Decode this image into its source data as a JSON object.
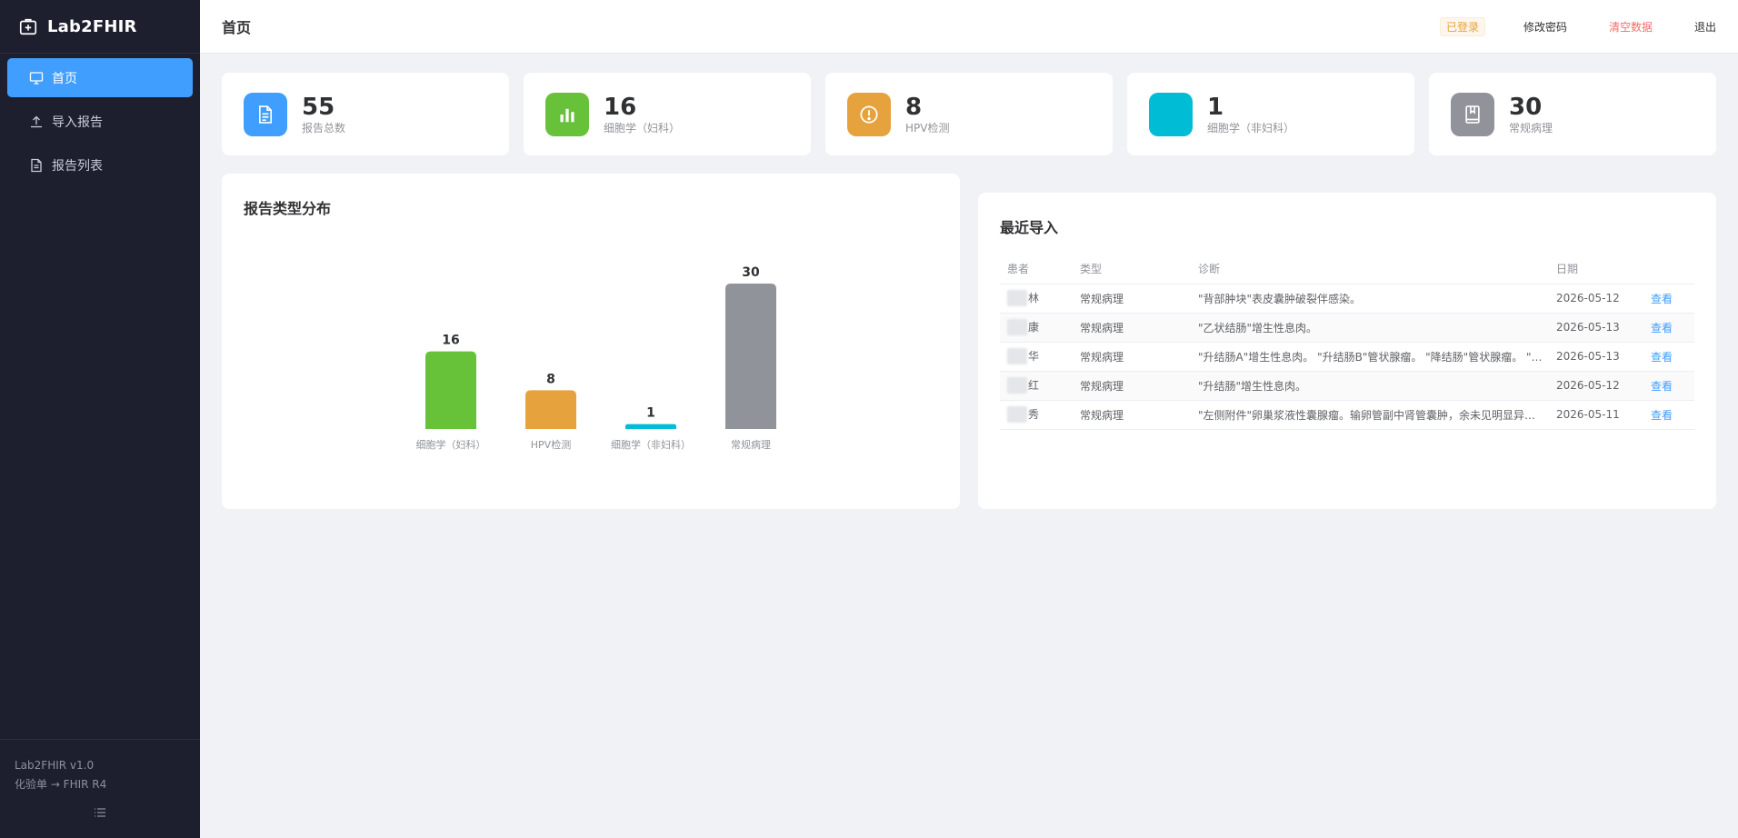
{
  "app": {
    "name": "Lab2FHIR"
  },
  "sidebar": {
    "items": [
      {
        "label": "首页",
        "icon": "monitor-icon",
        "active": true
      },
      {
        "label": "导入报告",
        "icon": "upload-icon",
        "active": false
      },
      {
        "label": "报告列表",
        "icon": "document-icon",
        "active": false
      }
    ],
    "footer": {
      "version": "Lab2FHIR v1.0",
      "tagline": "化验单 → FHIR R4"
    }
  },
  "header": {
    "title": "首页",
    "status": "已登录",
    "change_password": "修改密码",
    "clear_data": "清空数据",
    "logout": "退出"
  },
  "stats": [
    {
      "value": "55",
      "label": "报告总数",
      "color": "#409eff",
      "icon": "document-icon"
    },
    {
      "value": "16",
      "label": "细胞学（妇科）",
      "color": "#67c23a",
      "icon": "bar-chart-icon"
    },
    {
      "value": "8",
      "label": "HPV检测",
      "color": "#e6a23c",
      "icon": "warning-icon"
    },
    {
      "value": "1",
      "label": "细胞学（非妇科）",
      "color": "#00bcd4",
      "icon": ""
    },
    {
      "value": "30",
      "label": "常规病理",
      "color": "#909399",
      "icon": "book-icon"
    }
  ],
  "chart_panel": {
    "title": "报告类型分布"
  },
  "chart_data": {
    "type": "bar",
    "title": "报告类型分布",
    "categories": [
      "细胞学（妇科）",
      "HPV检测",
      "细胞学（非妇科）",
      "常规病理"
    ],
    "values": [
      16,
      8,
      1,
      30
    ],
    "colors": [
      "#67c23a",
      "#e6a23c",
      "#00bcd4",
      "#909399"
    ],
    "ylim": [
      0,
      30
    ],
    "grid": false
  },
  "recent": {
    "title": "最近导入",
    "columns": [
      "患者",
      "类型",
      "诊断",
      "日期",
      ""
    ],
    "rows": [
      {
        "patient": "林",
        "type": "常规病理",
        "diagnosis": "\"背部肿块\"表皮囊肿破裂伴感染。",
        "date": "2026-05-12",
        "action": "查看"
      },
      {
        "patient": "康",
        "type": "常规病理",
        "diagnosis": "\"乙状结肠\"增生性息肉。",
        "date": "2026-05-13",
        "action": "查看"
      },
      {
        "patient": "华",
        "type": "常规病理",
        "diagnosis": "\"升结肠A\"增生性息肉。 \"升结肠B\"管状腺瘤。 \"降结肠\"管状腺瘤。 \"…",
        "date": "2026-05-13",
        "action": "查看"
      },
      {
        "patient": "红",
        "type": "常规病理",
        "diagnosis": "\"升结肠\"增生性息肉。",
        "date": "2026-05-12",
        "action": "查看"
      },
      {
        "patient": "秀",
        "type": "常规病理",
        "diagnosis": "\"左侧附件\"卵巢浆液性囊腺瘤。输卵管副中肾管囊肿，余未见明显异…",
        "date": "2026-05-11",
        "action": "查看"
      }
    ]
  }
}
